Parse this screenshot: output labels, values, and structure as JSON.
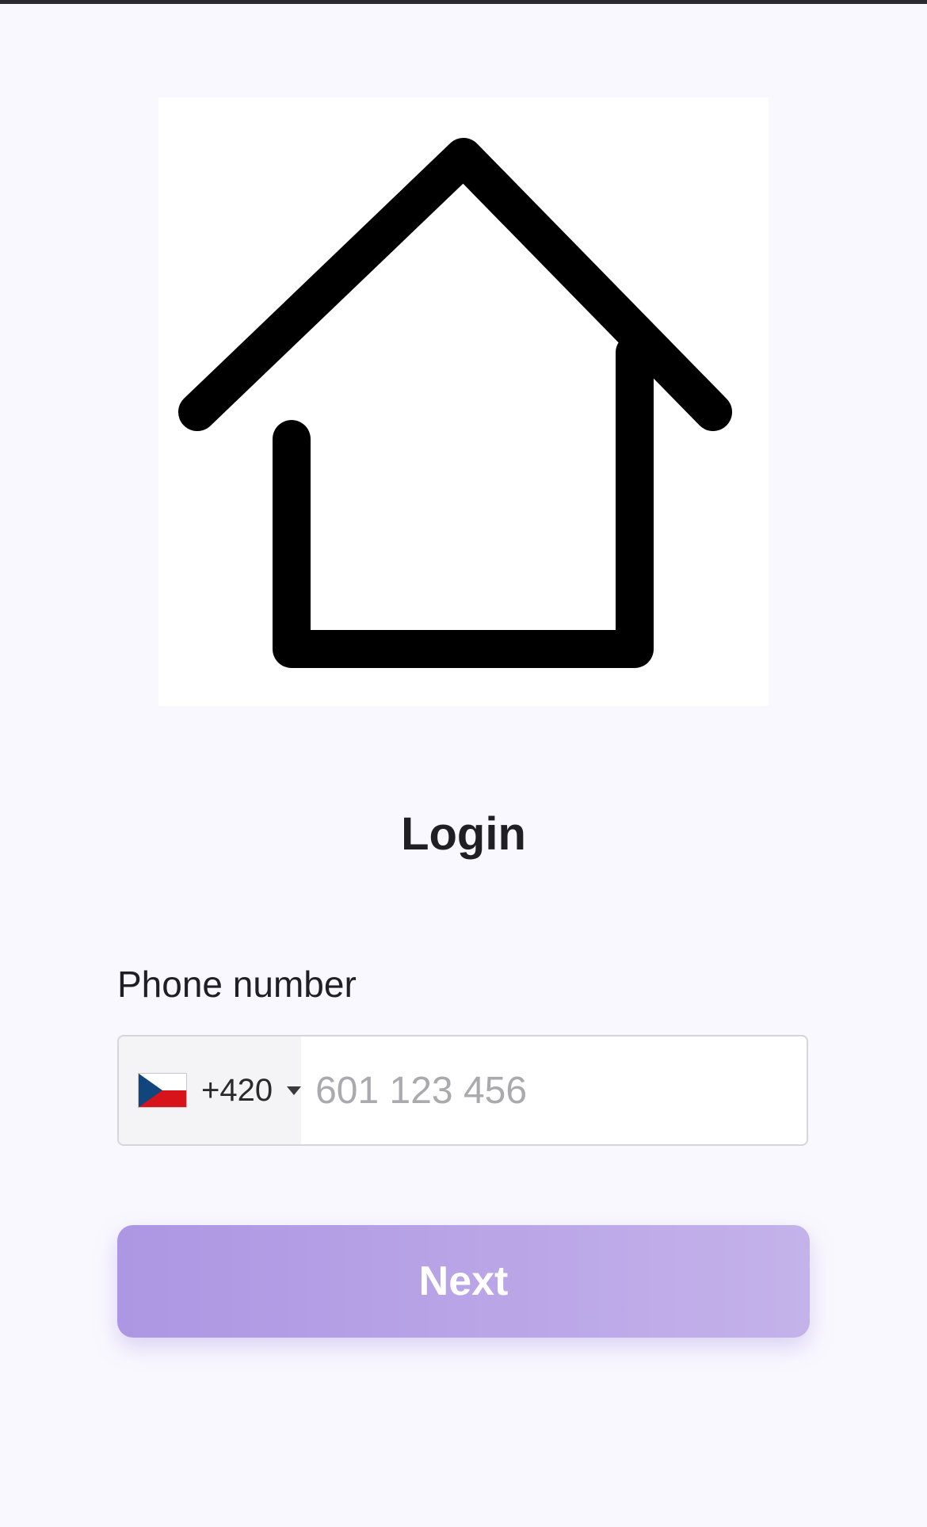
{
  "login": {
    "title": "Login",
    "phone_label": "Phone number",
    "country_code": "+420",
    "country_flag": "czech-republic-flag",
    "phone_placeholder": "601 123 456",
    "next_label": "Next"
  },
  "icons": {
    "logo": "house-icon",
    "dropdown": "caret-down-icon"
  },
  "colors": {
    "background": "#f9f8fe",
    "button_gradient_start": "#ad96e3",
    "button_gradient_end": "#c4b2ea",
    "button_text": "#ffffff"
  }
}
